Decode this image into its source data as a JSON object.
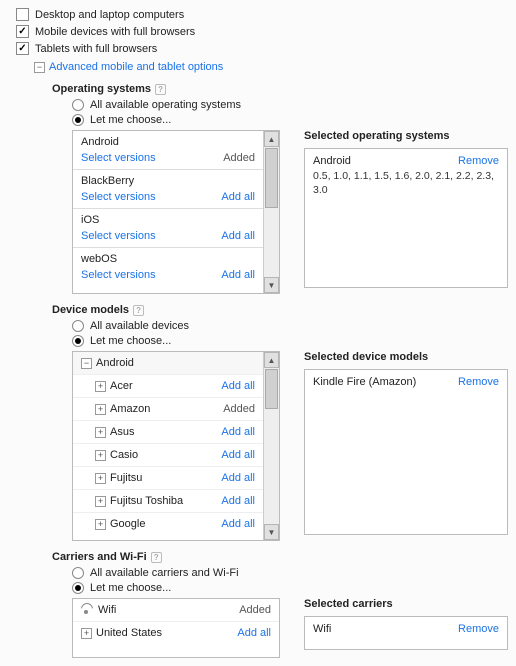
{
  "targeting": {
    "desktop": {
      "label": "Desktop and laptop computers",
      "checked": false
    },
    "mobile": {
      "label": "Mobile devices with full browsers",
      "checked": true
    },
    "tablet": {
      "label": "Tablets with full browsers",
      "checked": true
    }
  },
  "advanced_link": "Advanced mobile and tablet options",
  "os": {
    "title": "Operating systems",
    "all_label": "All available operating systems",
    "choose_label": "Let me choose...",
    "selection": "choose",
    "items": [
      {
        "name": "Android",
        "action": "Added",
        "select_versions": "Select versions"
      },
      {
        "name": "BlackBerry",
        "action": "Add all",
        "select_versions": "Select versions"
      },
      {
        "name": "iOS",
        "action": "Add all",
        "select_versions": "Select versions"
      },
      {
        "name": "webOS",
        "action": "Add all",
        "select_versions": "Select versions"
      }
    ],
    "selected_title": "Selected operating systems",
    "selected": [
      {
        "name": "Android",
        "remove": "Remove",
        "detail": "0.5, 1.0, 1.1, 1.5, 1.6, 2.0, 2.1, 2.2, 2.3, 3.0"
      }
    ]
  },
  "devices": {
    "title": "Device models",
    "all_label": "All available devices",
    "choose_label": "Let me choose...",
    "selection": "choose",
    "root": "Android",
    "items": [
      {
        "name": "Acer",
        "action": "Add all"
      },
      {
        "name": "Amazon",
        "action": "Added"
      },
      {
        "name": "Asus",
        "action": "Add all"
      },
      {
        "name": "Casio",
        "action": "Add all"
      },
      {
        "name": "Fujitsu",
        "action": "Add all"
      },
      {
        "name": "Fujitsu Toshiba",
        "action": "Add all"
      },
      {
        "name": "Google",
        "action": "Add all"
      }
    ],
    "selected_title": "Selected device models",
    "selected": [
      {
        "name": "Kindle Fire (Amazon)",
        "remove": "Remove"
      }
    ]
  },
  "carriers": {
    "title": "Carriers and Wi-Fi",
    "all_label": "All available carriers and Wi-Fi",
    "choose_label": "Let me choose...",
    "selection": "choose",
    "items": [
      {
        "name": "Wifi",
        "action": "Added",
        "icon": "wifi"
      },
      {
        "name": "United States",
        "action": "Add all",
        "icon": "expand"
      }
    ],
    "selected_title": "Selected carriers",
    "selected": [
      {
        "name": "Wifi",
        "remove": "Remove"
      }
    ]
  }
}
